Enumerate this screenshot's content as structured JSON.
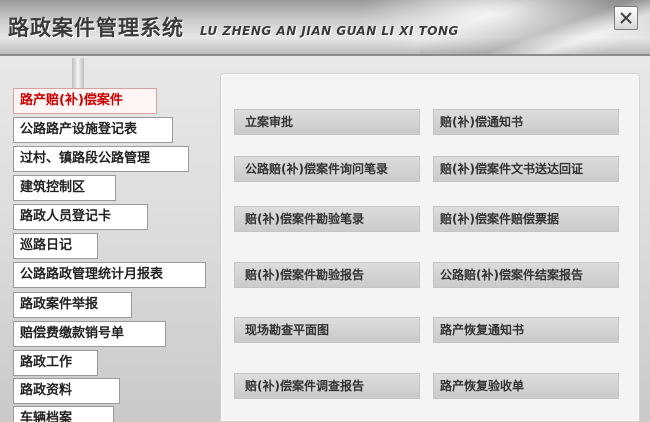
{
  "header": {
    "title_cn": "路政案件管理系统",
    "title_en": "LU ZHENG AN JIAN GUAN LI XI TONG",
    "close_icon": "close-icon"
  },
  "nav": {
    "items": [
      {
        "label": "路产赔(补)偿案件",
        "active": true
      },
      {
        "label": "公路路产设施登记表"
      },
      {
        "label": "过村、镇路段公路管理"
      },
      {
        "label": "建筑控制区"
      },
      {
        "label": "路政人员登记卡"
      },
      {
        "label": "巡路日记"
      },
      {
        "label": "公路路政管理统计月报表"
      },
      {
        "label": "路政案件举报"
      },
      {
        "label": "赔偿费缴款销号单"
      },
      {
        "label": "路政工作"
      },
      {
        "label": "路政资料"
      },
      {
        "label": "车辆档案"
      }
    ]
  },
  "actions": {
    "left": [
      "立案审批",
      "公路赔(补)偿案件询问笔录",
      "赔(补)偿案件勘验笔录",
      "赔(补)偿案件勘验报告",
      "现场勘查平面图",
      "赔(补)偿案件调查报告"
    ],
    "right": [
      "赔(补)偿通知书",
      "赔(补)偿案件文书送达回证",
      "赔(补)偿案件赔偿票据",
      "公路赔(补)偿案件结案报告",
      "路产恢复通知书",
      "路产恢复验收单"
    ]
  },
  "colors": {
    "active_text": "#cc0000",
    "button_bg": "#d3d3d3"
  }
}
